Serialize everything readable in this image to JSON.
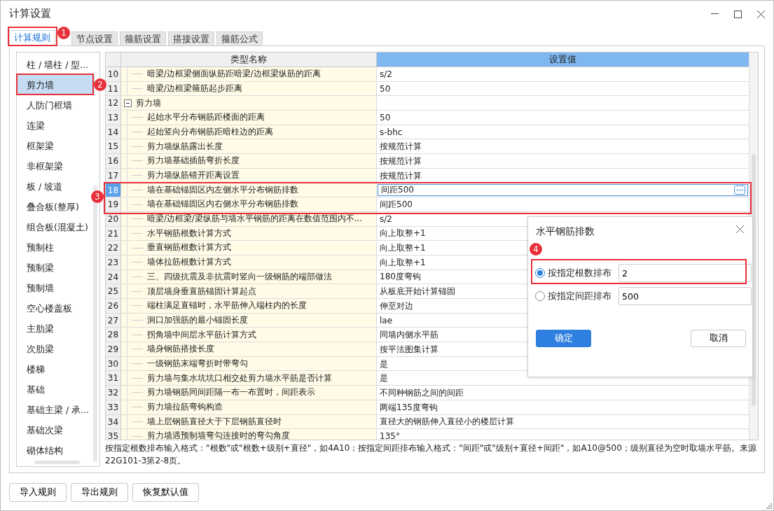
{
  "window": {
    "title": "计算设置"
  },
  "tabs": [
    {
      "label": "计算规则",
      "selected": true
    },
    {
      "label": "节点设置",
      "selected": false
    },
    {
      "label": "箍筋设置",
      "selected": false
    },
    {
      "label": "搭接设置",
      "selected": false
    },
    {
      "label": "箍筋公式",
      "selected": false
    }
  ],
  "categories": [
    {
      "label": "柱 / 墙柱 / 型...",
      "selected": false
    },
    {
      "label": "剪力墙",
      "selected": true
    },
    {
      "label": "人防门框墙",
      "selected": false
    },
    {
      "label": "连梁",
      "selected": false
    },
    {
      "label": "框架梁",
      "selected": false
    },
    {
      "label": "非框架梁",
      "selected": false
    },
    {
      "label": "板 / 坡道",
      "selected": false
    },
    {
      "label": "叠合板(整厚)",
      "selected": false
    },
    {
      "label": "组合板(混凝土)",
      "selected": false
    },
    {
      "label": "预制柱",
      "selected": false
    },
    {
      "label": "预制梁",
      "selected": false
    },
    {
      "label": "预制墙",
      "selected": false
    },
    {
      "label": "空心楼盖板",
      "selected": false
    },
    {
      "label": "主肋梁",
      "selected": false
    },
    {
      "label": "次肋梁",
      "selected": false
    },
    {
      "label": "楼梯",
      "selected": false
    },
    {
      "label": "基础",
      "selected": false
    },
    {
      "label": "基础主梁 / 承...",
      "selected": false
    },
    {
      "label": "基础次梁",
      "selected": false
    },
    {
      "label": "砌体结构",
      "selected": false
    }
  ],
  "table": {
    "columns": [
      "类型名称",
      "设置值"
    ],
    "rows": [
      {
        "number": "10",
        "kind": "item",
        "name": "暗梁/边框梁侧面纵筋距暗梁/边框梁纵筋的距离",
        "value": "s/2",
        "selected": false
      },
      {
        "number": "11",
        "kind": "item",
        "name": "暗梁/边框梁箍筋起步距离",
        "value": "50",
        "selected": false
      },
      {
        "number": "12",
        "kind": "group",
        "name": "剪力墙",
        "expanded": true,
        "selected": false
      },
      {
        "number": "13",
        "kind": "item",
        "name": "起始水平分布钢筋距楼面的距离",
        "value": "50",
        "selected": false
      },
      {
        "number": "14",
        "kind": "item",
        "name": "起始竖向分布钢筋距暗柱边的距离",
        "value": "s-bhc",
        "selected": false
      },
      {
        "number": "15",
        "kind": "item",
        "name": "剪力墙纵筋露出长度",
        "value": "按规范计算",
        "selected": false
      },
      {
        "number": "16",
        "kind": "item",
        "name": "剪力墙基础插筋弯折长度",
        "value": "按规范计算",
        "selected": false
      },
      {
        "number": "17",
        "kind": "item",
        "name": "剪力墙纵筋错开距离设置",
        "value": "按规范计算",
        "selected": false
      },
      {
        "number": "18",
        "kind": "item",
        "name": "墙在基础锚固区内左侧水平分布钢筋排数",
        "value": "间距500",
        "selected": true
      },
      {
        "number": "19",
        "kind": "item",
        "name": "墙在基础锚固区内右侧水平分布钢筋排数",
        "value": "间距500",
        "selected": false
      },
      {
        "number": "20",
        "kind": "item",
        "name": "暗梁/边框梁/梁纵筋与墙水平钢筋的距离在数值范围内不...",
        "value": "s/2",
        "selected": false
      },
      {
        "number": "21",
        "kind": "item",
        "name": "水平钢筋根数计算方式",
        "value": "向上取整+1",
        "selected": false
      },
      {
        "number": "22",
        "kind": "item",
        "name": "垂直钢筋根数计算方式",
        "value": "向上取整+1",
        "selected": false
      },
      {
        "number": "23",
        "kind": "item",
        "name": "墙体拉筋根数计算方式",
        "value": "向上取整+1",
        "selected": false
      },
      {
        "number": "24",
        "kind": "item",
        "name": "三、四级抗震及非抗震时竖向一级钢筋的端部做法",
        "value": "180度弯钩",
        "selected": false
      },
      {
        "number": "25",
        "kind": "item",
        "name": "顶层墙身垂直筋锚固计算起点",
        "value": "从板底开始计算锚固",
        "selected": false
      },
      {
        "number": "26",
        "kind": "item",
        "name": "端柱满足直锚时，水平筋伸入端柱内的长度",
        "value": "伸至对边",
        "selected": false
      },
      {
        "number": "27",
        "kind": "item",
        "name": "洞口加强筋的最小锚固长度",
        "value": "lae",
        "selected": false
      },
      {
        "number": "28",
        "kind": "item",
        "name": "拐角墙中间层水平筋计算方式",
        "value": "同墙内侧水平筋",
        "selected": false
      },
      {
        "number": "29",
        "kind": "item",
        "name": "墙身钢筋搭接长度",
        "value": "按平法图集计算",
        "selected": false
      },
      {
        "number": "30",
        "kind": "item",
        "name": "一级钢筋末端弯折时带弯勾",
        "value": "是",
        "selected": false
      },
      {
        "number": "31",
        "kind": "item",
        "name": "剪力墙与集水坑坑口相交处剪力墙水平筋是否计算",
        "value": "是",
        "selected": false
      },
      {
        "number": "32",
        "kind": "item",
        "name": "剪力墙钢筋同间距隔一布一布置时，间距表示",
        "value": "不同种钢筋之间的间距",
        "selected": false
      },
      {
        "number": "33",
        "kind": "item",
        "name": "剪力墙拉筋弯钩构造",
        "value": "两端135度弯钩",
        "selected": false
      },
      {
        "number": "34",
        "kind": "item",
        "name": "墙上层钢筋直径大于下层钢筋直径时",
        "value": "直径大的钢筋伸入直径小的楼层计算",
        "selected": false
      },
      {
        "number": "35",
        "kind": "item",
        "name": "剪力墙遇预制墙弯勾连接时的弯勾角度",
        "value": "135°",
        "selected": false
      }
    ]
  },
  "note": "按指定根数排布输入格式：\"根数\"或\"根数+级别+直径\"，如4A10；按指定间距排布输入格式：\"间距\"或\"级别+直径+间距\"，如A10@500；级别直径为空时取墙水平筋。来源22G101-3第2-8页。",
  "buttons": [
    "导入规则",
    "导出规则",
    "恢复默认值"
  ],
  "dialog": {
    "title": "水平钢筋排数",
    "options": [
      {
        "label": "按指定根数排布",
        "value": "2",
        "selected": true
      },
      {
        "label": "按指定间距排布",
        "value": "500",
        "selected": false
      }
    ],
    "buttons": [
      {
        "label": "确定",
        "kind": "primary"
      },
      {
        "label": "取消",
        "kind": "secondary"
      }
    ]
  },
  "annotations": [
    {
      "number": "1"
    },
    {
      "number": "2"
    },
    {
      "number": "3"
    },
    {
      "number": "4"
    }
  ]
}
